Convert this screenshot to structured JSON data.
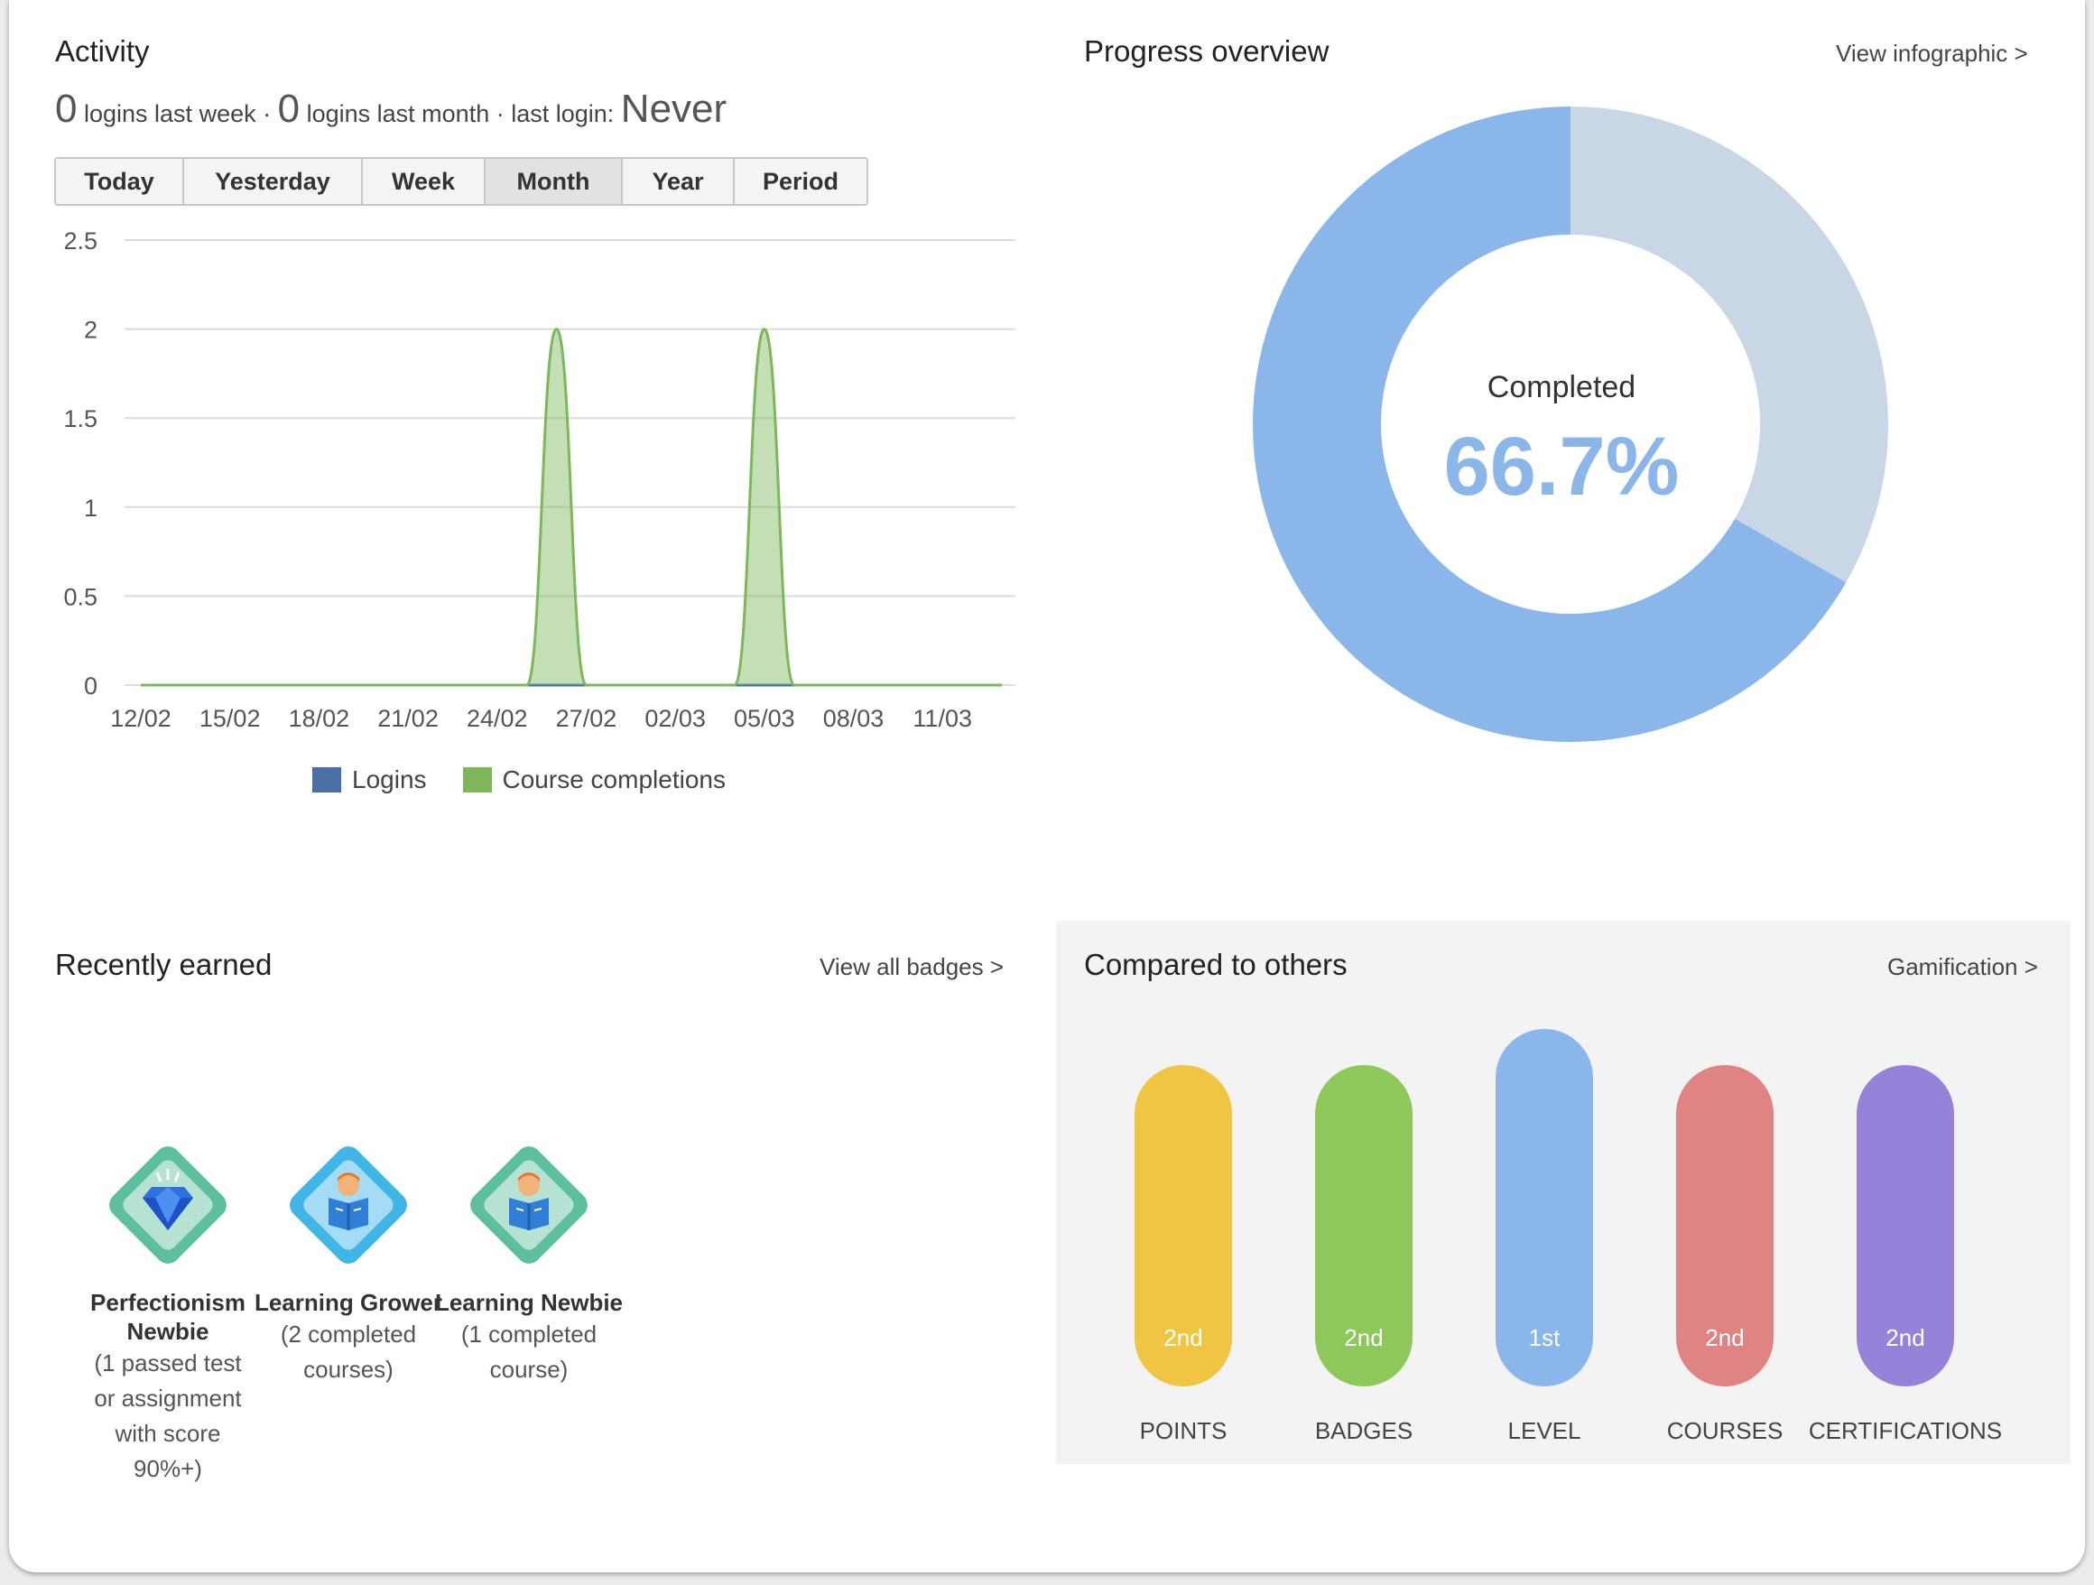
{
  "activity": {
    "title": "Activity",
    "logins_last_week": "0",
    "logins_last_week_label": "logins last week ·",
    "logins_last_month": "0",
    "logins_last_month_label": "logins last month · last login:",
    "last_login": "Never",
    "periods": [
      "Today",
      "Yesterday",
      "Week",
      "Month",
      "Year",
      "Period"
    ],
    "active_period": "Month"
  },
  "chart_data": {
    "type": "area",
    "categories": [
      "12/02",
      "13/02",
      "14/02",
      "15/02",
      "16/02",
      "17/02",
      "18/02",
      "19/02",
      "20/02",
      "21/02",
      "22/02",
      "23/02",
      "24/02",
      "25/02",
      "26/02",
      "27/02",
      "28/02",
      "01/03",
      "02/03",
      "03/03",
      "04/03",
      "05/03",
      "06/03",
      "07/03",
      "08/03",
      "09/03",
      "10/03",
      "11/03",
      "12/03",
      "13/03"
    ],
    "x_tick_labels": [
      "12/02",
      "15/02",
      "18/02",
      "21/02",
      "24/02",
      "27/02",
      "02/03",
      "05/03",
      "08/03",
      "11/03"
    ],
    "y_tick_labels": [
      "2.5",
      "2",
      "1.5",
      "1",
      "0.5",
      "0"
    ],
    "ylim": [
      0,
      2.5
    ],
    "grid": true,
    "legend_position": "bottom",
    "series": [
      {
        "name": "Logins",
        "color": "#4a6fa5",
        "values": [
          0,
          0,
          0,
          0,
          0,
          0,
          0,
          0,
          0,
          0,
          0,
          0,
          0,
          0,
          0,
          0,
          0,
          0,
          0,
          0,
          0,
          0,
          0,
          0,
          0,
          0,
          0,
          0,
          0,
          0
        ]
      },
      {
        "name": "Course completions",
        "color": "#7cb85a",
        "values": [
          0,
          0,
          0,
          0,
          0,
          0,
          0,
          0,
          0,
          0,
          0,
          0,
          0,
          0,
          2,
          0,
          0,
          0,
          0,
          0,
          0,
          2,
          0,
          0,
          0,
          0,
          0,
          0,
          0,
          0
        ]
      }
    ]
  },
  "progress": {
    "title": "Progress overview",
    "link": "View infographic >",
    "center_label": "Completed",
    "center_value": "66.7%",
    "completed_fraction": 0.667,
    "completed_color": "#8ab6ea",
    "remaining_color": "#c8d6e6"
  },
  "badges": {
    "title": "Recently earned",
    "link": "View all badges >",
    "items": [
      {
        "title": "Perfectionism Newbie",
        "desc": "(1 passed test or assignment with score 90%+)",
        "icon": "diamond-gem-icon",
        "color": "#5dbf9d"
      },
      {
        "title": "Learning Grower",
        "desc": "(2 completed courses)",
        "icon": "reader-book-icon",
        "color": "#3fb6e6"
      },
      {
        "title": "Learning Newbie",
        "desc": "(1 completed course)",
        "icon": "reader-book-icon",
        "color": "#5dbf9d"
      }
    ]
  },
  "compare": {
    "title": "Compared to others",
    "link": "Gamification >",
    "items": [
      {
        "label": "POINTS",
        "rank": "2nd",
        "color": "#f0c543"
      },
      {
        "label": "BADGES",
        "rank": "2nd",
        "color": "#8ec85b"
      },
      {
        "label": "LEVEL",
        "rank": "1st",
        "color": "#8ab6ea"
      },
      {
        "label": "COURSES",
        "rank": "2nd",
        "color": "#e08383"
      },
      {
        "label": "CERTIFICATIONS",
        "rank": "2nd",
        "color": "#9683d9"
      }
    ]
  }
}
